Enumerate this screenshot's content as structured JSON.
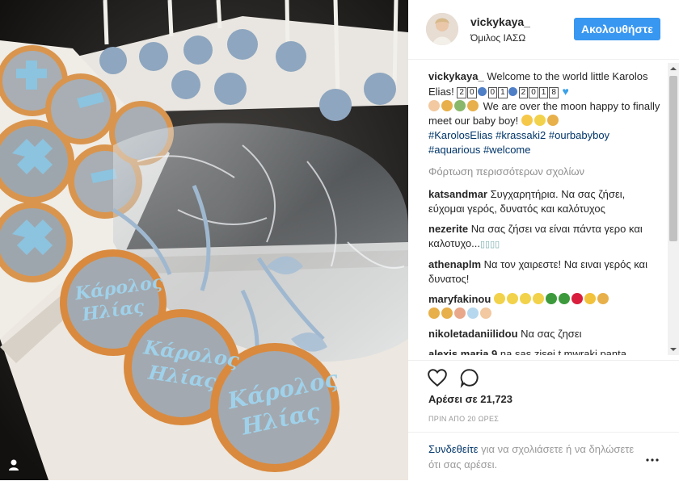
{
  "post": {
    "username": "vickykaya_",
    "location": "Όμιλος ΙΑΣΩ",
    "follow_label": "Ακολουθήστε",
    "caption": {
      "user": "vickykaya_",
      "text1": "Welcome to the world little Karolos Elias!",
      "date_digits": [
        "2",
        "0",
        "0",
        "1",
        "2",
        "0",
        "1",
        "8"
      ],
      "text2": "We are over the moon happy to finally meet our baby boy!",
      "hashtags": [
        "#KarolosElias",
        "#krassaki2",
        "#ourbabyboy",
        "#aquarious",
        "#welcome"
      ]
    },
    "load_more": "Φόρτωση περισσότερων σχολίων",
    "comments": [
      {
        "user": "katsandmar",
        "text": "Συγχαρητήρια. Να σας ζήσει, εύχομαι γερός, δυνατός και καλότυχος"
      },
      {
        "user": "nezerite",
        "text": "Να σας ζήσει να είναι πάντα γερο και καλοτυχο..."
      },
      {
        "user": "athenaplm",
        "text": "Να τον χαιρεστε! Να ειναι γερός και δυνατος!"
      },
      {
        "user": "maryfakinou",
        "text": ""
      },
      {
        "user": "nikoletadaniilidou",
        "text": "Να σας ζησει"
      },
      {
        "user": "alexis.maria.9",
        "text": "na sas zisei t mwraki panta"
      }
    ],
    "likes": "Αρέσει σε 21,723",
    "time": "ΠΡΙΝ ΑΠΟ 20 ΩΡΕΣ",
    "login_link": "Συνδεθείτε",
    "login_rest": " για να σχολιάσετε ή να δηλώσετε ότι σας αρέσει.",
    "photo_text": [
      "Κάρολος",
      "Ηλίας"
    ]
  },
  "colors": {
    "accent": "#3897f0",
    "link": "#003569",
    "muted": "#999999"
  },
  "icons": [
    "like-heart-icon",
    "comment-bubble-icon",
    "more-options-icon",
    "user-tag-icon",
    "baby-bottle-icon",
    "blue-heart-icon"
  ]
}
